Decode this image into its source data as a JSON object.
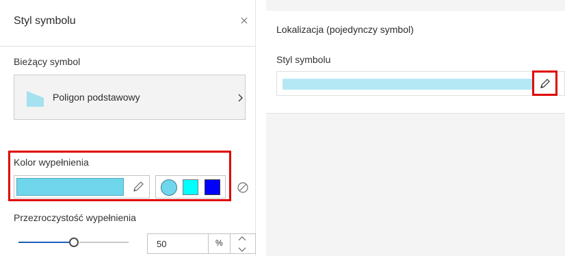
{
  "panel": {
    "title": "Styl symbolu",
    "close_icon": "close-icon"
  },
  "current_symbol": {
    "label": "Bieżący symbol",
    "name": "Poligon podstawowy",
    "swatch_color": "#a6e1f0"
  },
  "fill_color": {
    "label": "Kolor wypełnienia",
    "value": "#6fd6ec",
    "swatches": [
      {
        "shape": "circle",
        "color": "#6fd6ec"
      },
      {
        "shape": "square",
        "color": "#00ffff"
      },
      {
        "shape": "square",
        "color": "#0000ff"
      }
    ],
    "highlight_color": "#e00000"
  },
  "fill_opacity": {
    "label": "Przezroczystość wypełnienia",
    "value": "50",
    "unit": "%",
    "fraction": 0.5
  },
  "preview": {
    "title": "Lokalizacja (pojedynczy symbol)",
    "style_label": "Styl symbolu",
    "bar_color": "#b5e8f5"
  }
}
